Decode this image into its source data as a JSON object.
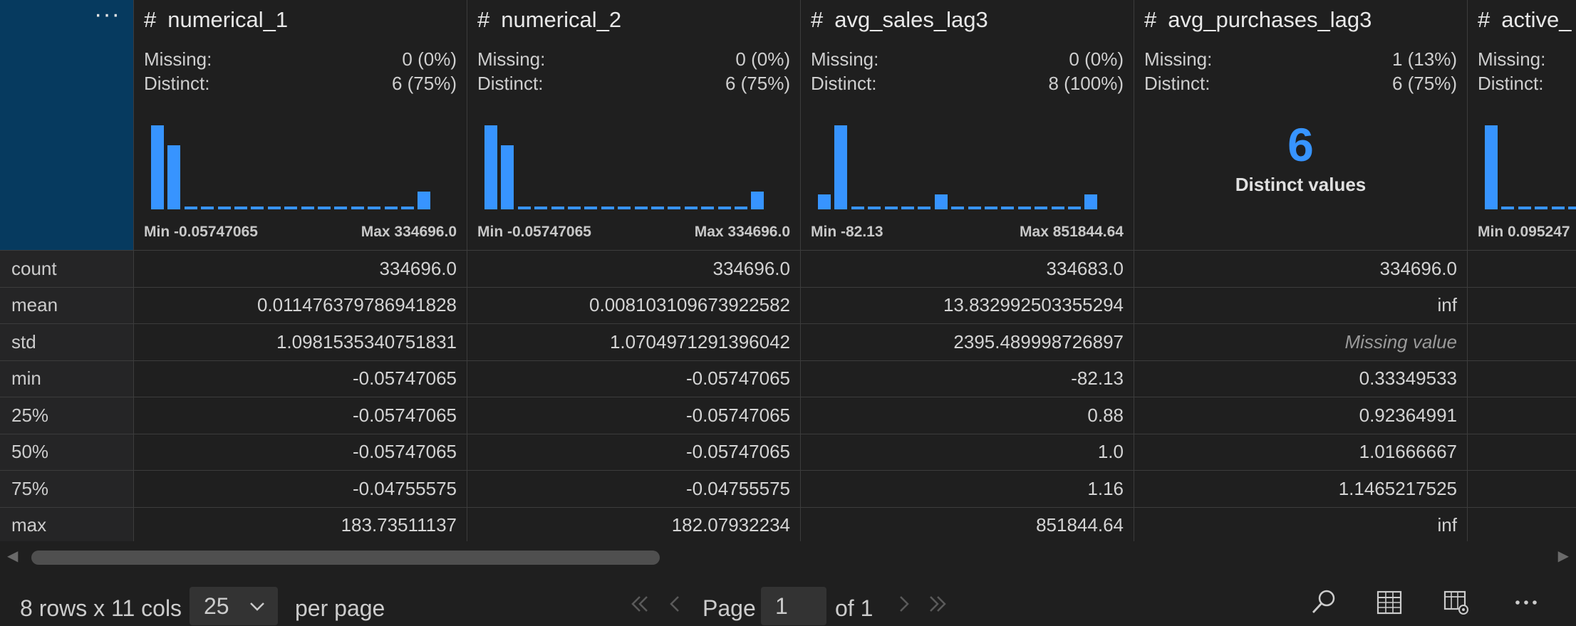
{
  "corner": {
    "menu_glyph": "···"
  },
  "columns": [
    {
      "name": "numerical_1",
      "type_icon": "#",
      "missing_label": "Missing:",
      "missing_value": "0 (0%)",
      "distinct_label": "Distinct:",
      "distinct_value": "6 (75%)",
      "min_text": "Min -0.05747065",
      "max_text": "Max 334696.0",
      "histogram": [
        100,
        76,
        3,
        3,
        3,
        3,
        3,
        3,
        3,
        3,
        3,
        3,
        3,
        3,
        3,
        3,
        21
      ]
    },
    {
      "name": "numerical_2",
      "type_icon": "#",
      "missing_label": "Missing:",
      "missing_value": "0 (0%)",
      "distinct_label": "Distinct:",
      "distinct_value": "6 (75%)",
      "min_text": "Min -0.05747065",
      "max_text": "Max 334696.0",
      "histogram": [
        100,
        76,
        3,
        3,
        3,
        3,
        3,
        3,
        3,
        3,
        3,
        3,
        3,
        3,
        3,
        3,
        21
      ]
    },
    {
      "name": "avg_sales_lag3",
      "type_icon": "#",
      "missing_label": "Missing:",
      "missing_value": "0 (0%)",
      "distinct_label": "Distinct:",
      "distinct_value": "8 (100%)",
      "min_text": "Min -82.13",
      "max_text": "Max 851844.64",
      "histogram": [
        18,
        100,
        3,
        3,
        3,
        3,
        3,
        18,
        3,
        3,
        3,
        3,
        3,
        3,
        3,
        3,
        18
      ]
    },
    {
      "name": "avg_purchases_lag3",
      "type_icon": "#",
      "missing_label": "Missing:",
      "missing_value": "1 (13%)",
      "distinct_label": "Distinct:",
      "distinct_value": "6 (75%)",
      "distinct_big": "6",
      "distinct_caption": "Distinct values"
    },
    {
      "name": "active_",
      "type_icon": "#",
      "missing_label": "Missing:",
      "distinct_label": "Distinct:",
      "min_text": "Min 0.095247",
      "histogram": [
        100,
        3,
        3,
        3,
        3,
        3,
        3,
        3,
        3,
        3,
        3,
        3,
        3,
        3,
        3,
        3,
        3
      ]
    }
  ],
  "rows": [
    {
      "label": "count",
      "values": [
        "334696.0",
        "334696.0",
        "334683.0",
        "334696.0"
      ]
    },
    {
      "label": "mean",
      "values": [
        "0.011476379786941828",
        "0.008103109673922582",
        "13.832992503355294",
        "inf"
      ]
    },
    {
      "label": "std",
      "values": [
        "1.0981535340751831",
        "1.0704971291396042",
        "2395.489998726897",
        "Missing value"
      ]
    },
    {
      "label": "min",
      "values": [
        "-0.05747065",
        "-0.05747065",
        "-82.13",
        "0.33349533"
      ]
    },
    {
      "label": "25%",
      "values": [
        "-0.05747065",
        "-0.05747065",
        "0.88",
        "0.92364991"
      ]
    },
    {
      "label": "50%",
      "values": [
        "-0.05747065",
        "-0.05747065",
        "1.0",
        "1.01666667"
      ]
    },
    {
      "label": "75%",
      "values": [
        "-0.04755575",
        "-0.04755575",
        "1.16",
        "1.1465217525"
      ]
    },
    {
      "label": "max",
      "values": [
        "183.73511137",
        "182.07932234",
        "851844.64",
        "inf"
      ]
    }
  ],
  "footer": {
    "rows_cols": "8 rows x 11 cols",
    "per_page_value": "25",
    "per_page_label": "per page",
    "page_label": "Page",
    "page_value": "1",
    "of_label": "of 1"
  },
  "colors": {
    "accent": "#3794ff",
    "corner_bg": "#063a5f",
    "background": "#1f1f1f"
  },
  "icons": [
    "first-page-icon",
    "prev-page-icon",
    "next-page-icon",
    "last-page-icon",
    "search-icon",
    "table-icon",
    "table-settings-icon",
    "more-icon",
    "chevron-down-icon"
  ]
}
